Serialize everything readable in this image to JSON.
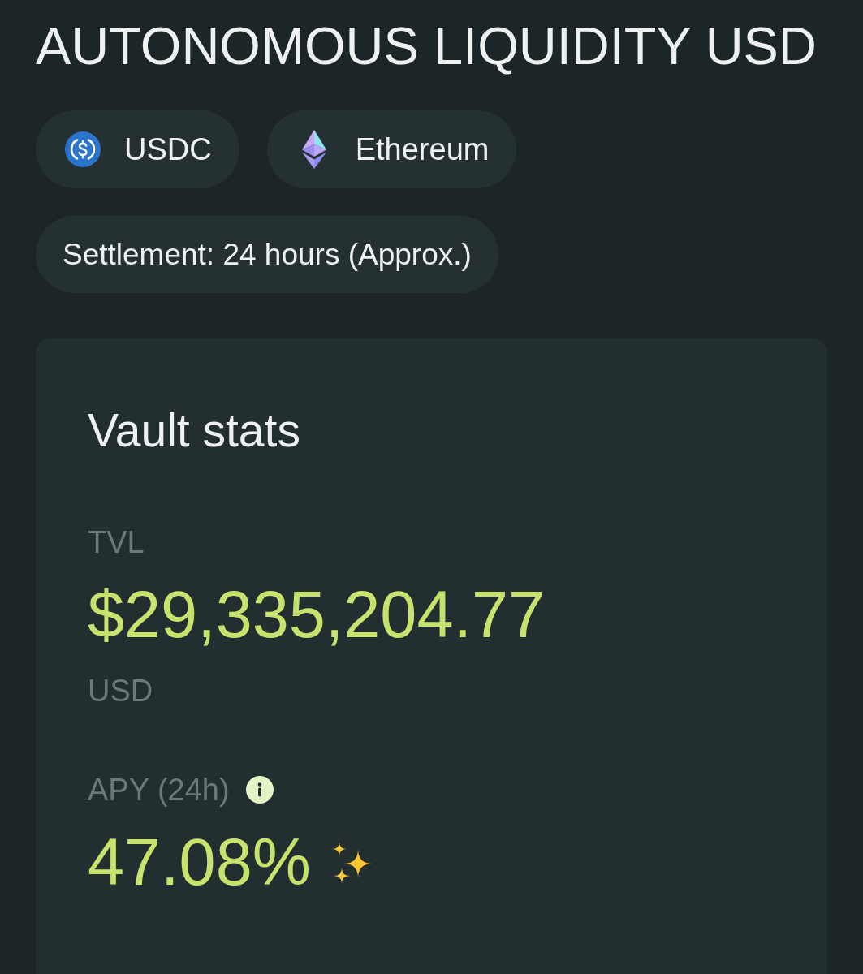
{
  "title": "AUTONOMOUS LIQUIDITY USD",
  "tags": [
    {
      "kind": "token",
      "label": "USDC"
    },
    {
      "kind": "network",
      "label": "Ethereum"
    }
  ],
  "settlement": "Settlement: 24 hours (Approx.)",
  "vault_stats": {
    "title": "Vault stats",
    "stats": [
      {
        "label": "TVL",
        "value": "$29,335,204.77",
        "unit": "USD"
      },
      {
        "label": "APY (24h)",
        "value": "47.08%",
        "info": true,
        "sparkle": true
      }
    ]
  }
}
